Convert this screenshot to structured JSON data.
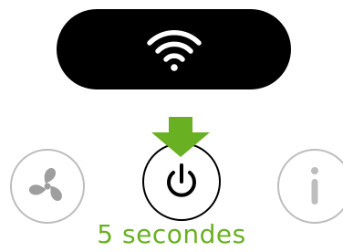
{
  "status_pill": {
    "icon": "wifi-icon"
  },
  "buttons": {
    "fan": {
      "icon": "fan-icon"
    },
    "power": {
      "icon": "power-icon"
    },
    "info": {
      "icon": "info-icon"
    }
  },
  "indicator": {
    "icon": "arrow-down-icon",
    "color": "#6ab023"
  },
  "instruction": {
    "text": "5 secondes"
  },
  "colors": {
    "accent": "#6ab023",
    "pill_background": "#000000",
    "inactive_icon": "#bdbdbd"
  }
}
